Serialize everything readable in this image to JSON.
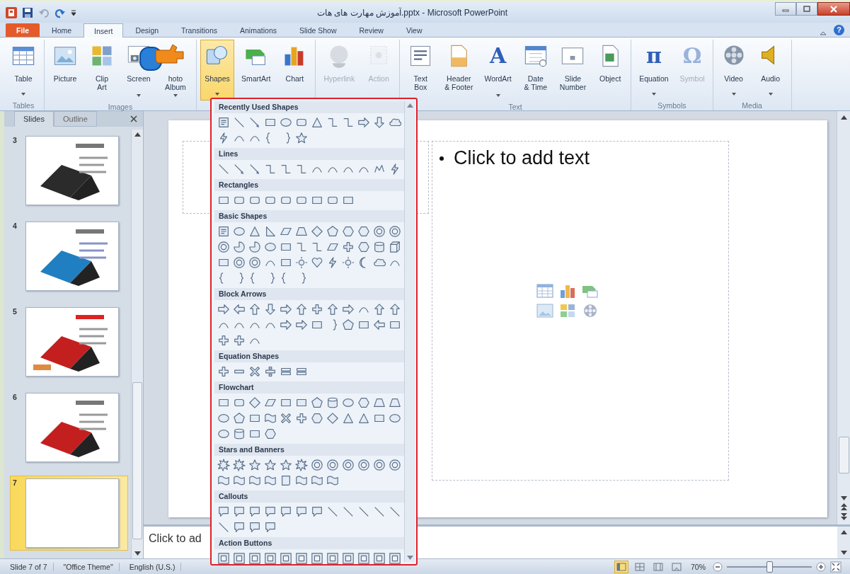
{
  "window": {
    "title": "آموزش مهارت های هات.pptx - Microsoft PowerPoint"
  },
  "tabs": [
    {
      "label": "File",
      "selected": false,
      "kind": "file"
    },
    {
      "label": "Home",
      "selected": false,
      "kind": "tab"
    },
    {
      "label": "Insert",
      "selected": true,
      "kind": "tab"
    },
    {
      "label": "Design",
      "selected": false,
      "kind": "tab"
    },
    {
      "label": "Transitions",
      "selected": false,
      "kind": "tab"
    },
    {
      "label": "Animations",
      "selected": false,
      "kind": "tab"
    },
    {
      "label": "Slide Show",
      "selected": false,
      "kind": "tab"
    },
    {
      "label": "Review",
      "selected": false,
      "kind": "tab"
    },
    {
      "label": "View",
      "selected": false,
      "kind": "tab"
    }
  ],
  "help": "?",
  "ribbon": {
    "groups": [
      {
        "label": "Tables",
        "buttons": [
          {
            "label": "Table",
            "dropdown": true,
            "disabled": false,
            "expanded": false
          }
        ]
      },
      {
        "label": "Images",
        "buttons": [
          {
            "label": "Picture",
            "dropdown": false,
            "disabled": false,
            "expanded": false
          },
          {
            "label": "Clip\nArt",
            "dropdown": false,
            "disabled": false,
            "expanded": false
          },
          {
            "label": "Screen",
            "dropdown": true,
            "disabled": false,
            "expanded": false
          },
          {
            "label": "hoto\nAlbum",
            "dropdown": true,
            "disabled": false,
            "expanded": false
          }
        ]
      },
      {
        "buttons": [
          {
            "label": "Shapes",
            "dropdown": true,
            "disabled": false,
            "expanded": true
          },
          {
            "label": "SmartArt",
            "dropdown": false,
            "disabled": false,
            "expanded": false
          },
          {
            "label": "Chart",
            "dropdown": false,
            "disabled": false,
            "expanded": false
          }
        ]
      },
      {
        "buttons": [
          {
            "label": "Hyperlink",
            "dropdown": false,
            "disabled": true,
            "expanded": false
          },
          {
            "label": "Action",
            "dropdown": false,
            "disabled": true,
            "expanded": false
          }
        ]
      },
      {
        "label": "Text",
        "buttons": [
          {
            "label": "Text\nBox",
            "dropdown": false,
            "disabled": false,
            "expanded": false
          },
          {
            "label": "Header\n& Footer",
            "dropdown": false,
            "disabled": false,
            "expanded": false
          },
          {
            "label": "WordArt",
            "glyph": "A",
            "dropdown": true,
            "disabled": false,
            "expanded": false
          },
          {
            "label": "Date\n& Time",
            "dropdown": false,
            "disabled": false,
            "expanded": false
          },
          {
            "label": "Slide\nNumber",
            "dropdown": false,
            "disabled": false,
            "expanded": false
          },
          {
            "label": "Object",
            "dropdown": false,
            "disabled": false,
            "expanded": false
          }
        ]
      },
      {
        "label": "Symbols",
        "buttons": [
          {
            "label": "Equation",
            "glyph": "π",
            "dropdown": true,
            "disabled": false,
            "expanded": false
          },
          {
            "label": "Symbol",
            "glyph": "Ω",
            "dropdown": false,
            "disabled": true,
            "expanded": false
          }
        ]
      },
      {
        "label": "Media",
        "buttons": [
          {
            "label": "Video",
            "dropdown": true,
            "disabled": false,
            "expanded": false
          },
          {
            "label": "Audio",
            "dropdown": true,
            "disabled": false,
            "expanded": false
          }
        ]
      }
    ]
  },
  "shapes_menu": {
    "sections": [
      {
        "title": "Recently Used Shapes"
      },
      {
        "title": "Lines"
      },
      {
        "title": "Rectangles"
      },
      {
        "title": "Basic Shapes"
      },
      {
        "title": "Block Arrows"
      },
      {
        "title": "Equation Shapes"
      },
      {
        "title": "Flowchart"
      },
      {
        "title": "Stars and Banners"
      },
      {
        "title": "Callouts"
      },
      {
        "title": "Action Buttons"
      }
    ]
  },
  "pane_tabs": [
    {
      "label": "Slides",
      "selected": true
    },
    {
      "label": "Outline",
      "selected": false
    }
  ],
  "slides": [
    {
      "number": "3",
      "selected": false
    },
    {
      "number": "4",
      "selected": false
    },
    {
      "number": "5",
      "selected": false
    },
    {
      "number": "6",
      "selected": false
    },
    {
      "number": "7",
      "selected": true
    }
  ],
  "slide": {
    "body_placeholder": "Click to add text"
  },
  "notes": {
    "placeholder": "Click to ad"
  },
  "status_bar": {
    "items": [
      "Slide 7 of 7",
      "\"Office Theme\"",
      "English (U.S.)"
    ],
    "views": [
      {
        "selected": true
      },
      {
        "selected": false
      },
      {
        "selected": false
      },
      {
        "selected": false
      }
    ],
    "zoom": {
      "reading": "70%",
      "level": 0.5
    }
  }
}
